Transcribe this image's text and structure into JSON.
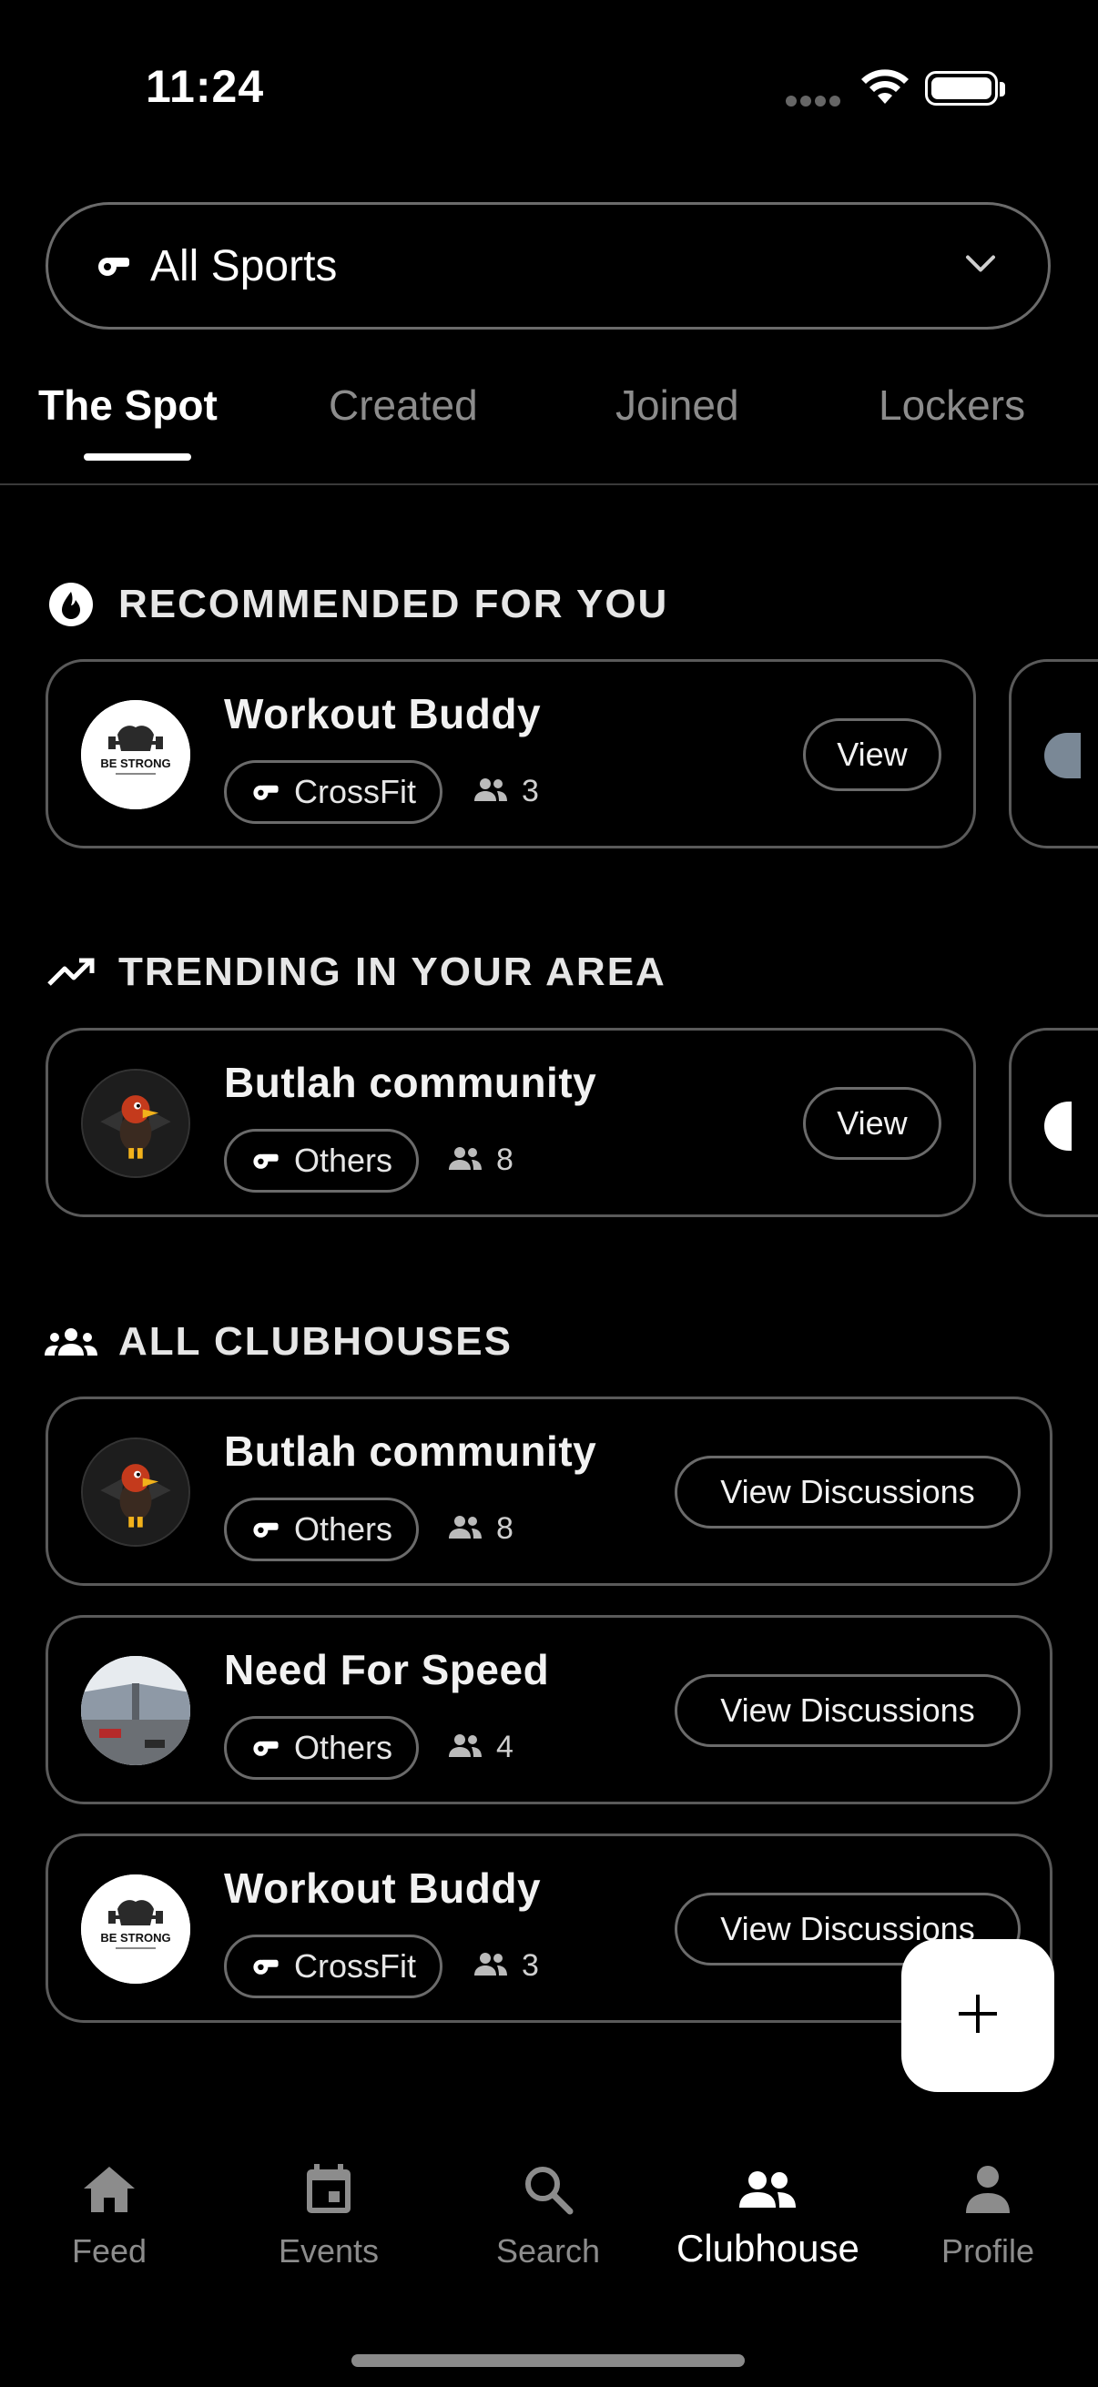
{
  "status_bar": {
    "time": "11:24"
  },
  "filter": {
    "selected": "All Sports",
    "icon": "whistle-icon"
  },
  "tabs": [
    {
      "label": "The Spot",
      "active": true
    },
    {
      "label": "Created",
      "active": false
    },
    {
      "label": "Joined",
      "active": false
    },
    {
      "label": "Lockers",
      "active": false
    }
  ],
  "sections": {
    "recommended": {
      "title": "RECOMMENDED FOR YOU",
      "icon": "fire-icon"
    },
    "trending": {
      "title": "TRENDING IN YOUR AREA",
      "icon": "trending-up-icon"
    },
    "all": {
      "title": "ALL CLUBHOUSES",
      "icon": "groups-icon"
    }
  },
  "recommended": [
    {
      "name": "Workout Buddy",
      "sport": "CrossFit",
      "members": "3",
      "action": "View"
    }
  ],
  "trending": [
    {
      "name": "Butlah community",
      "sport": "Others",
      "members": "8",
      "action": "View"
    }
  ],
  "clubhouses": [
    {
      "name": "Butlah community",
      "sport": "Others",
      "members": "8",
      "action": "View Discussions"
    },
    {
      "name": "Need For Speed",
      "sport": "Others",
      "members": "4",
      "action": "View Discussions"
    },
    {
      "name": "Workout Buddy",
      "sport": "CrossFit",
      "members": "3",
      "action": "View Discussions"
    }
  ],
  "avatar_text": {
    "be_strong": "BE STRONG"
  },
  "fab": {
    "icon": "plus-icon"
  },
  "nav": [
    {
      "label": "Feed",
      "icon": "home-icon",
      "active": false
    },
    {
      "label": "Events",
      "icon": "calendar-icon",
      "active": false
    },
    {
      "label": "Search",
      "icon": "search-icon",
      "active": false
    },
    {
      "label": "Clubhouse",
      "icon": "groups-icon",
      "active": true
    },
    {
      "label": "Profile",
      "icon": "person-icon",
      "active": false
    }
  ]
}
